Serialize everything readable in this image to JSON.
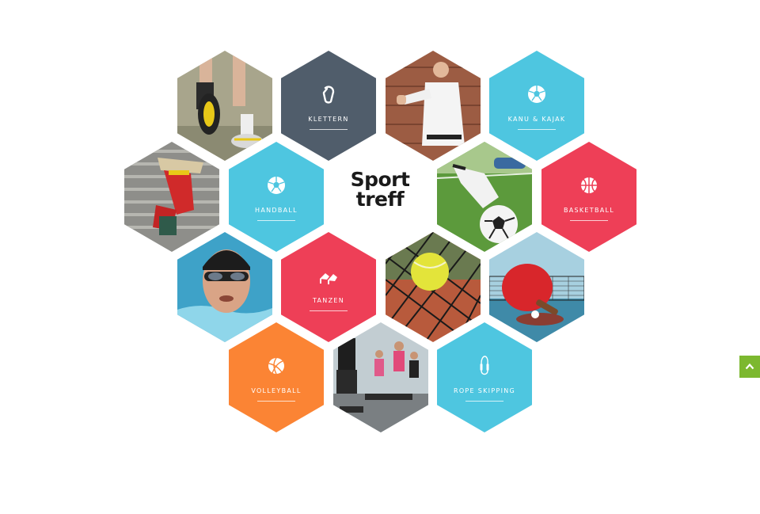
{
  "tiles": [
    {
      "label": "KLETTERN",
      "icon": "carabiner-icon",
      "color": "#505d6b"
    },
    {
      "label": "KANU & KAJAK",
      "icon": "ball-icon",
      "color": "#4ec6e0"
    },
    {
      "label": "HANDBALL",
      "icon": "ball-icon",
      "color": "#4ec6e0"
    },
    {
      "label": "BASKETBALL",
      "icon": "basketball-icon",
      "color": "#ee3f57"
    },
    {
      "label": "TANZEN",
      "icon": "dance-shoes-icon",
      "color": "#ee3f57"
    },
    {
      "label": "VOLLEYBALL",
      "icon": "volleyball-icon",
      "color": "#fb8434"
    },
    {
      "label": "ROPE SKIPPING",
      "icon": "jump-rope-icon",
      "color": "#4ec6e0"
    }
  ],
  "logo": {
    "line1": "Sport",
    "line2": "treff"
  },
  "back_to_top": {
    "icon": "chevron-up-icon",
    "color": "#7cb82f"
  }
}
